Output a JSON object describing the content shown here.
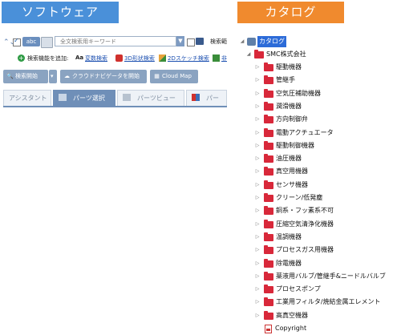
{
  "headers": {
    "left": "ソフトウェア",
    "right": "カタログ"
  },
  "software": {
    "abc_label": "abc",
    "search_placeholder": "全文検索用キーワード",
    "search_target_label": "検索範",
    "add_function_label": "検索機能を追加:",
    "functions": [
      {
        "prefix": "Aa",
        "label": "変数検索"
      },
      {
        "label": "3D形状検索"
      },
      {
        "label": "2Dスケッチ検索"
      },
      {
        "label": "非"
      }
    ],
    "buttons": {
      "start_search": "検索開始",
      "cloud_navigator": "クラウドナビゲータを開始",
      "cloud_map": "Cloud Map"
    },
    "tabs": [
      "アシスタント",
      "パーツ選択",
      "パーツビュー",
      "パー"
    ],
    "active_tab": 1
  },
  "catalog": {
    "root": "カタログ",
    "company": "SMC株式会社",
    "categories": [
      "駆動機器",
      "管継手",
      "空気圧補助機器",
      "潤滑機器",
      "方向制御弁",
      "電動アクチュエータ",
      "駆動制御機器",
      "油圧機器",
      "真空用機器",
      "センサ機器",
      "クリーン/低発塵",
      "銅系・フッ素系不可",
      "圧縮空気清浄化機器",
      "温調機器",
      "プロセスガス用機器",
      "除電機器",
      "薬液用バルブ/管継手&ニードルバルブ",
      "プロセスポンプ",
      "工業用フィルタ/焼結金属エレメント",
      "高真空機器"
    ],
    "copyright": "Copyright"
  }
}
